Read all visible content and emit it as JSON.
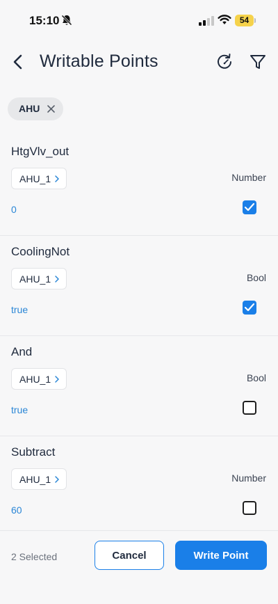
{
  "status_bar": {
    "time": "15:10",
    "battery": "54",
    "icons": [
      "bell-off-icon",
      "cellular-signal-icon",
      "wifi-icon",
      "battery-icon"
    ]
  },
  "header": {
    "title": "Writable Points",
    "icons": [
      "chevron-left-icon",
      "refresh-icon",
      "filter-icon"
    ]
  },
  "filter_chip": {
    "label": "AHU"
  },
  "points": [
    {
      "name": "HtgVlv_out",
      "device": "AHU_1",
      "type": "Number",
      "value": "0",
      "checked": true
    },
    {
      "name": "CoolingNot",
      "device": "AHU_1",
      "type": "Bool",
      "value": "true",
      "checked": true
    },
    {
      "name": "And",
      "device": "AHU_1",
      "type": "Bool",
      "value": "true",
      "checked": false
    },
    {
      "name": "Subtract",
      "device": "AHU_1",
      "type": "Number",
      "value": "60",
      "checked": false
    }
  ],
  "footer": {
    "selected_text": "2 Selected",
    "cancel_label": "Cancel",
    "write_label": "Write Point"
  },
  "colors": {
    "accent": "#1a7fe8",
    "value_text": "#2a86d6",
    "battery": "#f5d24b"
  }
}
